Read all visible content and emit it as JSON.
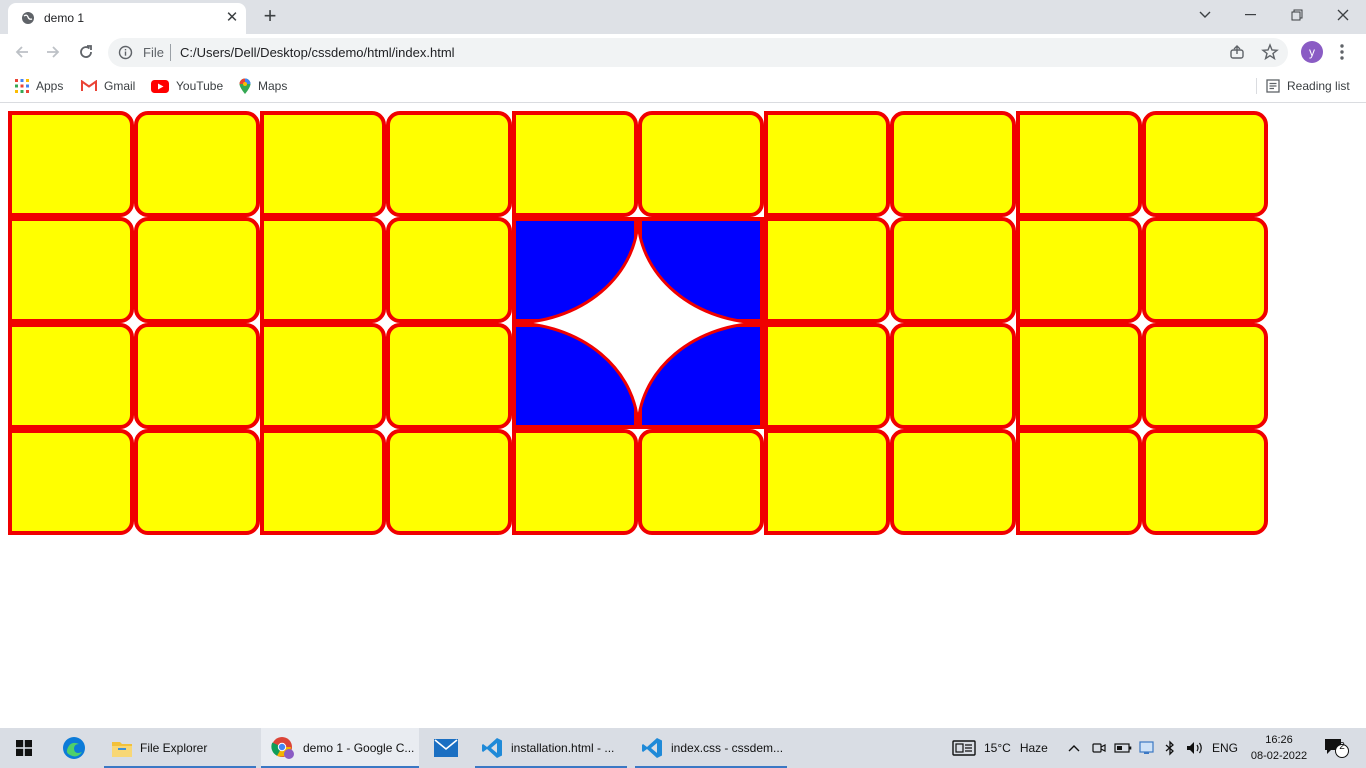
{
  "browser": {
    "tab": {
      "title": "demo 1"
    },
    "omnibox": {
      "scheme_label": "File",
      "url": "C:/Users/Dell/Desktop/cssdemo/html/index.html"
    },
    "profile_initial": "y",
    "bookmarks": [
      {
        "label": "Apps",
        "icon": "apps-grid-icon"
      },
      {
        "label": "Gmail",
        "icon": "gmail-icon"
      },
      {
        "label": "YouTube",
        "icon": "youtube-icon"
      },
      {
        "label": "Maps",
        "icon": "maps-pin-icon"
      }
    ],
    "reading_list": "Reading list"
  },
  "page": {
    "grid": {
      "columns": 10,
      "rows": 4,
      "cell_color": "#ffff00",
      "border_color": "#f00000",
      "highlight_color": "#0000ff",
      "highlight_cells": [
        [
          1,
          4
        ],
        [
          1,
          5
        ],
        [
          2,
          4
        ],
        [
          2,
          5
        ]
      ]
    }
  },
  "taskbar": {
    "items": [
      {
        "label": "File Explorer",
        "icon": "folder-icon"
      },
      {
        "label": "demo 1 - Google C...",
        "icon": "chrome-icon"
      },
      {
        "label": "",
        "icon": "mail-icon"
      },
      {
        "label": "installation.html - ...",
        "icon": "vscode-icon"
      },
      {
        "label": "index.css - cssdem...",
        "icon": "vscode-icon"
      }
    ],
    "weather": {
      "temp": "15°C",
      "condition": "Haze"
    },
    "language": "ENG",
    "time": "16:26",
    "date": "08-02-2022",
    "notification_count": "2"
  }
}
